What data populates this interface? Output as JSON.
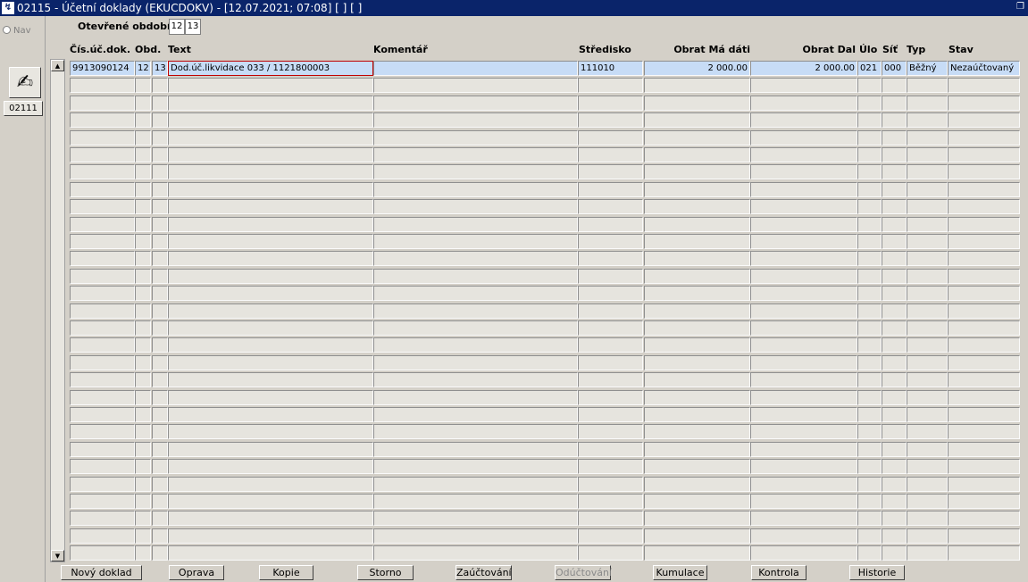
{
  "window": {
    "title": "02115 - Účetní doklady (EKUCDOKV) - [12.07.2021; 07:08]  [ ] [ ]",
    "app_icon": "app-logo-icon",
    "restore_icon": "restore-window-icon"
  },
  "sidebar": {
    "nav_label": "Nav",
    "tool_icon": "pen-on-paper-icon",
    "code_button_label": "02111"
  },
  "header": {
    "open_period_label": "Otevřené období",
    "period_from": "12",
    "period_to": "13"
  },
  "grid": {
    "columns": [
      {
        "key": "cis",
        "label": "Čís.úč.dok."
      },
      {
        "key": "obd",
        "label": "Obd."
      },
      {
        "key": "text",
        "label": "Text"
      },
      {
        "key": "komentar",
        "label": "Komentář"
      },
      {
        "key": "stredisko",
        "label": "Středisko"
      },
      {
        "key": "obrat_md",
        "label": "Obrat Má dáti"
      },
      {
        "key": "obrat_dal",
        "label": "Obrat Dal"
      },
      {
        "key": "ulo",
        "label": "Úlo"
      },
      {
        "key": "sit",
        "label": "Síť"
      },
      {
        "key": "typ",
        "label": "Typ"
      },
      {
        "key": "stav",
        "label": "Stav"
      }
    ],
    "rows": [
      {
        "cis": "9913090124",
        "obd1": "12",
        "obd2": "13",
        "text": "Dod.úč.likvidace 033 / 1121800003",
        "komentar": "",
        "stredisko": "111010",
        "obrat_md": "2 000.00",
        "obrat_dal": "2 000.00",
        "ulo": "021",
        "sit": "000",
        "typ": "Běžný",
        "stav": "Nezaúčtovaný"
      }
    ],
    "visible_row_count": 29,
    "scroll_up_icon": "scroll-up-arrow-icon",
    "scroll_down_icon": "scroll-down-arrow-icon"
  },
  "footer": {
    "buttons": [
      {
        "label": "Nový doklad",
        "enabled": true
      },
      {
        "label": "Oprava",
        "enabled": true
      },
      {
        "label": "Kopie",
        "enabled": true
      },
      {
        "label": "Storno",
        "enabled": true
      },
      {
        "label": "Zaúčtování",
        "enabled": true
      },
      {
        "label": "Odúčtování",
        "enabled": false
      },
      {
        "label": "Kumulace",
        "enabled": true
      },
      {
        "label": "Kontrola",
        "enabled": true
      },
      {
        "label": "Historie",
        "enabled": true
      }
    ]
  }
}
